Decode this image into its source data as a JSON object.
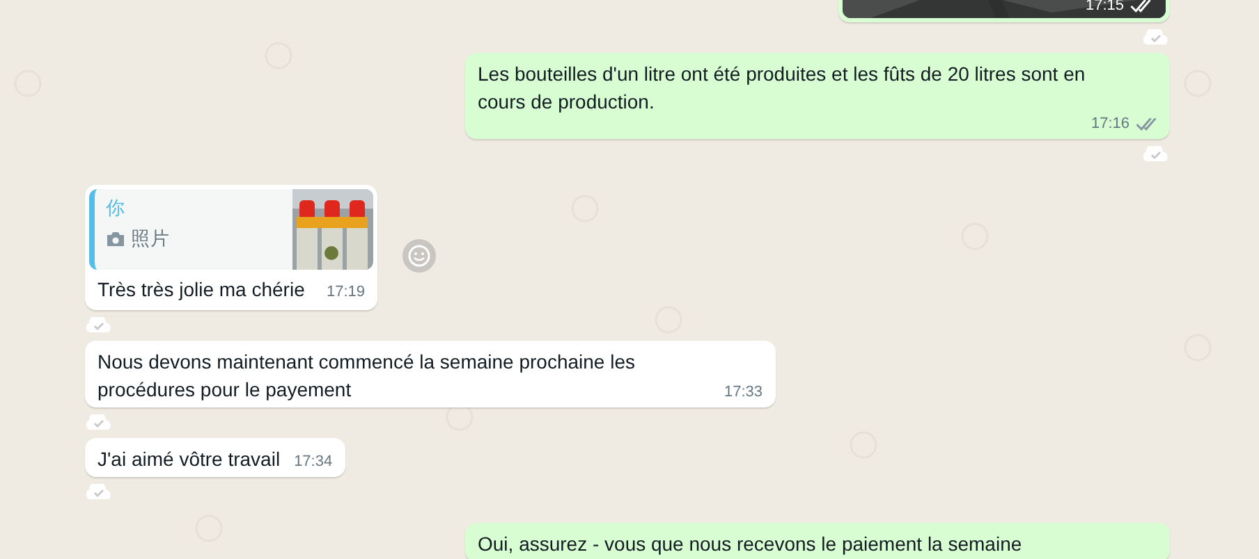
{
  "messages": [
    {
      "outgoing": true,
      "time": "17:15",
      "ticks": true
    },
    {
      "kind": "text",
      "outgoing": true,
      "text": "Les bouteilles d'un litre ont été produites et les fûts de 20 litres sont en cours de production.",
      "time": "17:16",
      "ticks": true
    },
    {
      "kind": "quote",
      "outgoing": false,
      "quote": {
        "author": "你",
        "label": "照片"
      },
      "text": "Très très jolie ma chérie",
      "time": "17:19",
      "emoji_button": true
    },
    {
      "kind": "text",
      "outgoing": false,
      "text": "Nous devons maintenant commencé la semaine prochaine les procédures pour le payement",
      "time": "17:33"
    },
    {
      "kind": "text",
      "outgoing": false,
      "text": "J'ai aimé vôtre travail",
      "time": "17:34"
    },
    {
      "kind": "text",
      "outgoing": true,
      "text": "Oui, assurez - vous que nous recevons le paiement la semaine"
    }
  ]
}
